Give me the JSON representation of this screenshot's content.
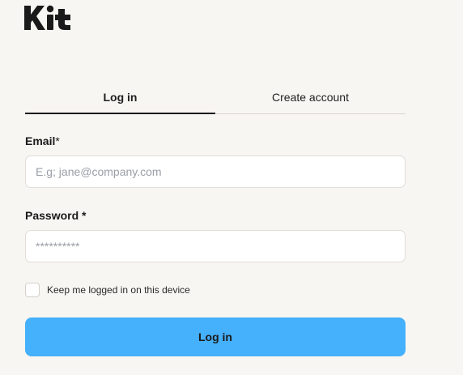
{
  "brand": {
    "logo_text": "Kit"
  },
  "tabs": [
    {
      "label": "Log in",
      "active": true
    },
    {
      "label": "Create account",
      "active": false
    }
  ],
  "form": {
    "email": {
      "label": "Email",
      "required_mark": "*",
      "placeholder": "E.g; jane@company.com",
      "value": ""
    },
    "password": {
      "label": "Password",
      "required_mark": " *",
      "placeholder": "**********",
      "value": ""
    },
    "remember": {
      "label": "Keep me logged in on this device",
      "checked": false
    },
    "submit_label": "Log in"
  },
  "colors": {
    "background": "#f8f6f2",
    "button": "#45b0fb",
    "text": "#1a1a1a"
  }
}
